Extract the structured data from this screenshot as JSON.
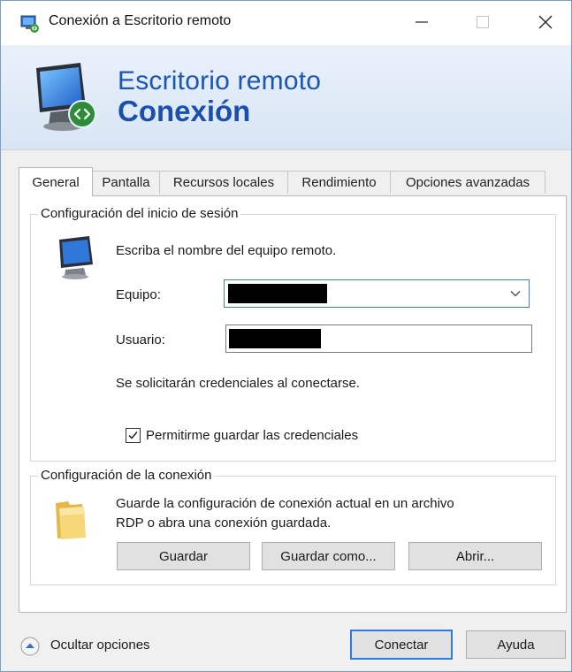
{
  "window": {
    "title": "Conexión a Escritorio remoto"
  },
  "banner": {
    "line1": "Escritorio remoto",
    "line2": "Conexión"
  },
  "tabs": [
    {
      "label": "General",
      "active": true
    },
    {
      "label": "Pantalla",
      "active": false
    },
    {
      "label": "Recursos locales",
      "active": false
    },
    {
      "label": "Rendimiento",
      "active": false
    },
    {
      "label": "Opciones avanzadas",
      "active": false
    }
  ],
  "login_group": {
    "title": "Configuración del inicio de sesión",
    "instruction": "Escriba el nombre del equipo remoto.",
    "computer_label": "Equipo:",
    "computer_value": "",
    "user_label": "Usuario:",
    "user_value": "",
    "credentials_note": "Se solicitarán credenciales al conectarse.",
    "save_credentials_label": "Permitirme guardar las credenciales",
    "save_credentials_checked": true
  },
  "connection_group": {
    "title": "Configuración de la conexión",
    "description_line1": "Guarde la configuración de conexión actual en un archivo",
    "description_line2": "RDP o abra una conexión guardada.",
    "save_button": "Guardar",
    "save_as_button": "Guardar como...",
    "open_button": "Abrir..."
  },
  "footer": {
    "hide_options_label": "Ocultar opciones",
    "connect_button": "Conectar",
    "help_button": "Ayuda"
  },
  "colors": {
    "accent": "#2f7ad6",
    "banner_text": "#1a56b8"
  }
}
